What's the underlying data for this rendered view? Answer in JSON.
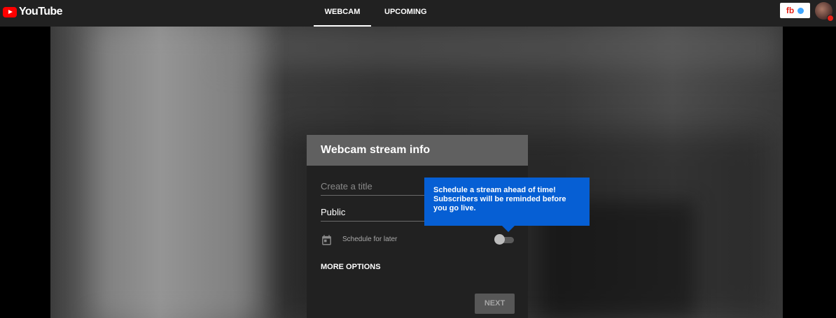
{
  "brand": {
    "logo_text": "YouTube"
  },
  "nav": {
    "tabs": [
      {
        "label": "WEBCAM",
        "active": true
      },
      {
        "label": "UPCOMING",
        "active": false
      }
    ]
  },
  "header_right": {
    "badge_text": "fb"
  },
  "card": {
    "title": "Webcam stream info",
    "title_placeholder": "Create a title",
    "privacy_value": "Public",
    "schedule_label": "Schedule for later",
    "schedule_enabled": false,
    "more_options_label": "MORE OPTIONS",
    "next_label": "NEXT"
  },
  "tooltip": {
    "text": "Schedule a stream ahead of time! Subscribers will be reminded before you go live."
  },
  "colors": {
    "brand_red": "#ff0000",
    "tooltip_blue": "#065fd4",
    "topbar": "#212121"
  }
}
